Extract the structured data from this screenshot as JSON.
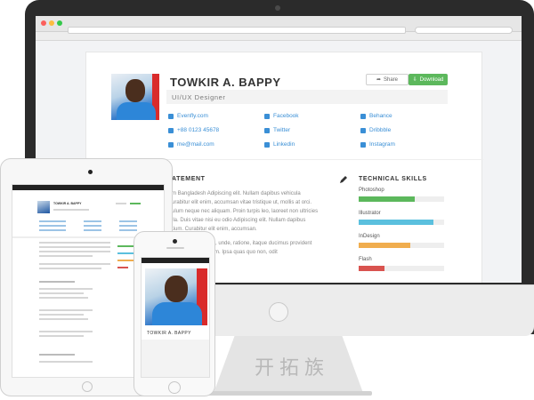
{
  "desktop": {
    "name": "TOWKIR A. BAPPY",
    "role": "UI/UX Designer",
    "buttons": {
      "share": "Share",
      "download": "Download"
    },
    "contacts": [
      {
        "icon": "globe-icon",
        "label": "Evenfly.com"
      },
      {
        "icon": "phone-icon",
        "label": "+88 0123 45678"
      },
      {
        "icon": "email-icon",
        "label": "me@mail.com"
      },
      {
        "icon": "facebook-icon",
        "label": "Facebook"
      },
      {
        "icon": "twitter-icon",
        "label": "Twitter"
      },
      {
        "icon": "linkedin-icon",
        "label": "Linkedin"
      },
      {
        "icon": "behance-icon",
        "label": "Behance"
      },
      {
        "icon": "dribbble-icon",
        "label": "Dribbble"
      },
      {
        "icon": "instagram-icon",
        "label": "Instagram"
      }
    ],
    "statement_title": "ATEMENT",
    "statement_lines": [
      "m Bangladesh Adipiscing elit. Nullam dapibus vehicula",
      "urabitur elit enim, accumsan vitae tristique ut, mollis at orci.",
      "ulum neque nec aliquam. Proin turpis leo, laoreet non ultricies",
      "lla. Duis vitae nisi eu odio Adipiscing elit. Nullam dapibus",
      "tium. Curabitur elit enim, accumsan.",
      "",
      "ine ipsam et omne, unde, ratione, itaque ducimus provident",
      "t dignissimos autem. Ipsa quas quo non, odit"
    ],
    "skills_title": "TECHNICAL SKILLS",
    "skills": [
      {
        "label": "Photoshop",
        "level": 0.66,
        "color": "#5cb85c"
      },
      {
        "label": "Illustrator",
        "level": 0.88,
        "color": "#5bc0de"
      },
      {
        "label": "InDesign",
        "level": 0.6,
        "color": "#f0ad4e"
      },
      {
        "label": "Flash",
        "level": 0.3,
        "color": "#d9534f"
      }
    ]
  },
  "tablet": {
    "name": "TOWKIR A. BAPPY"
  },
  "phone": {
    "name": "TOWKIR A. BAPPY"
  },
  "watermark": "开拓族"
}
